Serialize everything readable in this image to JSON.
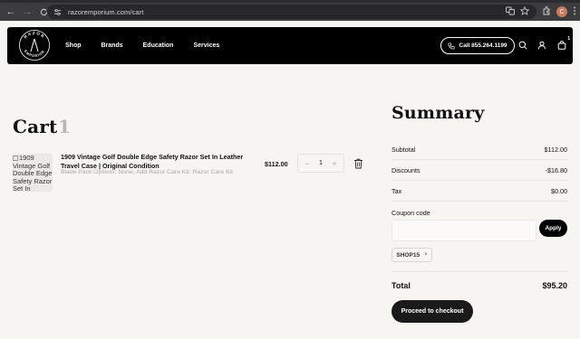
{
  "browser": {
    "url": "razoremporium.com/cart",
    "profile_initial": "C"
  },
  "header": {
    "logo_top_text": "RAZOR",
    "logo_bottom_text": "EMPORIUM",
    "nav": [
      "Shop",
      "Brands",
      "Education",
      "Services"
    ],
    "call_label": "Call 855.264.1199",
    "cart_badge": "1"
  },
  "cart": {
    "title": "Cart",
    "count": "1",
    "item": {
      "image_alt": "1909 Vintage Golf Double Edge Safety Razor Set In",
      "name": "1909 Vintage Golf Double Edge Safety Razor Set In Leather Travel Case | Original Condition",
      "options": "Blade Pack Options: None, Add Razor Care Kit: Razor Care Kit",
      "price": "$112.00",
      "quantity": "1",
      "minus": "−",
      "plus": "+"
    }
  },
  "summary": {
    "title": "Summary",
    "subtotal_label": "Subtotal",
    "subtotal_value": "$112.00",
    "discounts_label": "Discounts",
    "discounts_value": "-$16.80",
    "tax_label": "Tax",
    "tax_value": "$0.00",
    "coupon_label": "Coupon code",
    "coupon_placeholder": "",
    "apply_label": "Apply",
    "applied_coupon": "SHOP15",
    "remove_symbol": "×",
    "total_label": "Total",
    "total_value": "$95.20",
    "checkout_label": "Proceed to checkout"
  },
  "colors": {
    "page_bg": "#f7f5f2",
    "header_bg": "#000000",
    "button_dark": "#1a1a1a",
    "muted_text": "#a8a6a3"
  }
}
